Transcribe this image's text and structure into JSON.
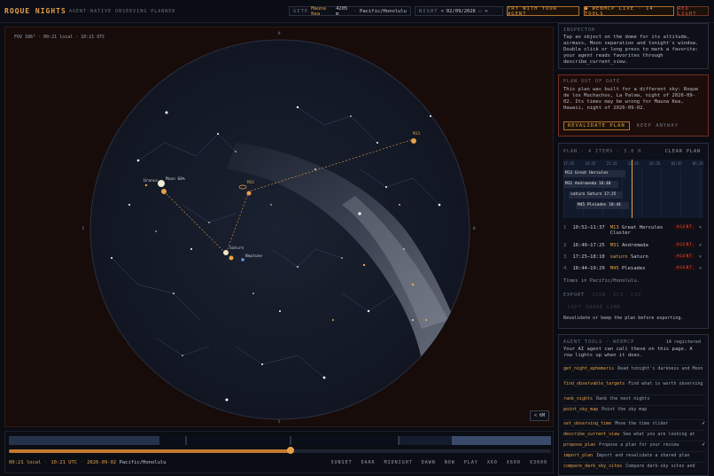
{
  "header": {
    "brand": "ROQUE NIGHTS",
    "tagline": "AGENT-NATIVE OBSERVING PLANNER",
    "site_label": "SITE",
    "site_name": "Mauna Kea",
    "site_elev": "4205 m",
    "site_sep": "·",
    "site_tz": "Pacific/Honolulu",
    "night_label": "NIGHT",
    "night_prev": "<",
    "night_date": "02/09/2026",
    "calendar_glyph": "▭",
    "night_next": ">",
    "try_agent": "TRY WITH YOUR AGENT",
    "webmcp_status": "● WEBMCP LIVE · 14 TOOLS",
    "red_light": "RED LIGHT"
  },
  "sky": {
    "fov_label": "FOV 186° · 00:21 local · 10:21 UTC",
    "magnitude_button": "< 6M",
    "compass": {
      "n": "N",
      "s": "S",
      "e": "E",
      "w": "W"
    },
    "labels": {
      "uranus": "Uranus",
      "moon": "Moon 60%",
      "m13": "M13",
      "m31": "M31",
      "saturn": "Saturn",
      "neptune": "Neptune"
    }
  },
  "timeline": {
    "progress": 0.523,
    "readout_local": "00:21 local",
    "readout_sep1": "·",
    "readout_utc": "10:21 UTC",
    "readout_sep2": "·",
    "readout_date": "2026-09-02",
    "readout_tz": "Pacific/Honolulu",
    "buttons": [
      "SUNSET",
      "DARK",
      "MIDNIGHT",
      "DAWN",
      "NOW",
      "PLAY",
      "X60",
      "X600",
      "X3600"
    ]
  },
  "inspector": {
    "title": "INSPECTOR",
    "text": "Tap an object on the dome for its altitude, airmass, Moon separation and tonight's window. Double click or long press to mark a favorite: your agent reads favorites through describe_current_view."
  },
  "warning": {
    "title": "PLAN OUT OF DATE",
    "text": "This plan was built for a different sky: Roque de los Muchachos, La Palma, night of 2026-09-02. Its times may be wrong for Mauna Kea, Hawaii, night of 2026-09-02.",
    "revalidate": "REVALIDATE PLAN",
    "keep": "KEEP ANYWAY"
  },
  "plan": {
    "title": "PLAN · 4 ITEMS · 3.0 H",
    "clear": "CLEAR PLAN",
    "gantt_hours": [
      "17:35",
      "19:35",
      "21:35",
      "23:35",
      "01:35",
      "03:35",
      "05:35"
    ],
    "gantt_bars": [
      "M13 Great Hercules",
      "M31 Andromeda 16:40",
      "saturn Saturn 17:25",
      "M45 Pleiades 18:44"
    ],
    "items": [
      {
        "n": "1",
        "time": "10:52–11:37",
        "id": "M13",
        "name": "Great Hercules Cluster",
        "tag": "AGENT",
        "x": "×"
      },
      {
        "n": "2",
        "time": "16:40–17:25",
        "id": "M31",
        "name": "Andromeda",
        "tag": "AGENT",
        "x": "×"
      },
      {
        "n": "3",
        "time": "17:25–18:10",
        "id": "saturn",
        "name": "Saturn",
        "tag": "AGENT",
        "x": "×"
      },
      {
        "n": "4",
        "time": "18:44–19:29",
        "id": "M45",
        "name": "Pleiades",
        "tag": "AGENT",
        "x": "×"
      }
    ],
    "tz_note": "Times in Pacific/Honolulu.",
    "export_label": "EXPORT",
    "export_json": "JSON",
    "export_ics": "ICS",
    "export_csv": "CSV",
    "copy_link": "COPY SHARE LINK",
    "export_note": "Revalidate or keep the plan before exporting."
  },
  "agent_tools": {
    "title": "AGENT TOOLS · WEBMCP",
    "count": "14 registered",
    "intro": "Your AI agent can call these on this page. A row lights up when it does.",
    "check_glyph": "✓",
    "tools": [
      {
        "name": "get_night_ephemeris",
        "desc": "Read tonight's darkness and Moon",
        "check": false
      },
      {
        "name": "find_observable_targets",
        "desc": "Find what is worth observing",
        "check": false
      },
      {
        "name": "rank_nights",
        "desc": "Rank the next nights",
        "check": false
      },
      {
        "name": "point_sky_map",
        "desc": "Point the sky map",
        "check": false
      },
      {
        "name": "set_observing_time",
        "desc": "Move the time slider",
        "check": true
      },
      {
        "name": "describe_current_view",
        "desc": "See what you are looking at",
        "check": false
      },
      {
        "name": "propose_plan",
        "desc": "Propose a plan for your review",
        "check": true
      },
      {
        "name": "import_plan",
        "desc": "Import and revalidate a shared plan",
        "check": false
      },
      {
        "name": "compare_dark_sky_sites",
        "desc": "Compare dark-sky sites and",
        "check": false
      }
    ]
  },
  "colors": {
    "accent": "#e8a048",
    "warning": "#e05040",
    "dome": "#141a26",
    "frame": "#170c0a"
  }
}
